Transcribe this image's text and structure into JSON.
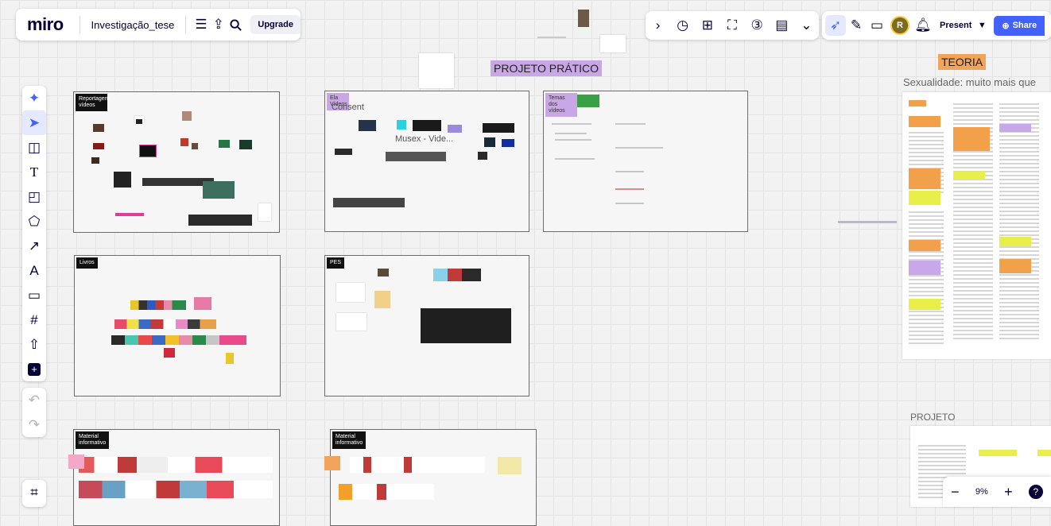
{
  "app": {
    "logo": "miro",
    "board_name": "Investigação_tese",
    "upgrade_label": "Upgrade"
  },
  "topbar_right": {
    "present_label": "Present",
    "share_label": "Share",
    "avatar_initial": "R"
  },
  "headings": {
    "projeto_pratico": "PROJETO PRÁTICO",
    "teoria": "TEORIA",
    "teoria_subtitle": "Sexualidade: muito mais que sexo",
    "projeto": "PROJETO"
  },
  "frames": {
    "reportagens": "Reportagens vídeos",
    "ela_videos": "Ela Vídeos",
    "consent": "Consent",
    "musex": "Musex - Vide...",
    "temas": "Temas dos vídeos",
    "livros": "Livros",
    "pes": "PES",
    "material1": "Material informativo",
    "material2": "Material informativo"
  },
  "zoom": {
    "level": "9%"
  },
  "colors": {
    "accent": "#4262ff",
    "heading_purple": "#c9a6e6",
    "heading_orange": "#f2a45a",
    "frame_border": "#6d6d6d"
  }
}
